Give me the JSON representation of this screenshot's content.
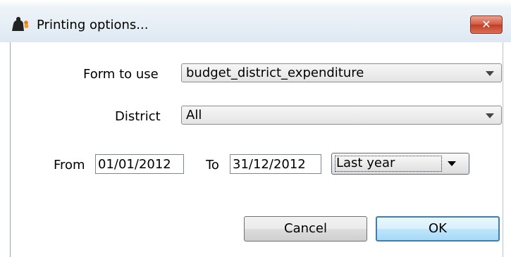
{
  "window": {
    "title": "Printing options...",
    "close_glyph": "✕",
    "app_icon": "app-logo-icon"
  },
  "form": {
    "form_label": "Form to use",
    "form_value": "budget_district_expenditure",
    "district_label": "District",
    "district_value": "All",
    "from_label": "From",
    "from_value": "01/01/2012",
    "to_label": "To",
    "to_value": "31/12/2012",
    "period_value": "Last year"
  },
  "buttons": {
    "cancel": "Cancel",
    "ok": "OK"
  },
  "colors": {
    "close_button": "#c94a30",
    "ok_button_border": "#3c7fb1"
  }
}
